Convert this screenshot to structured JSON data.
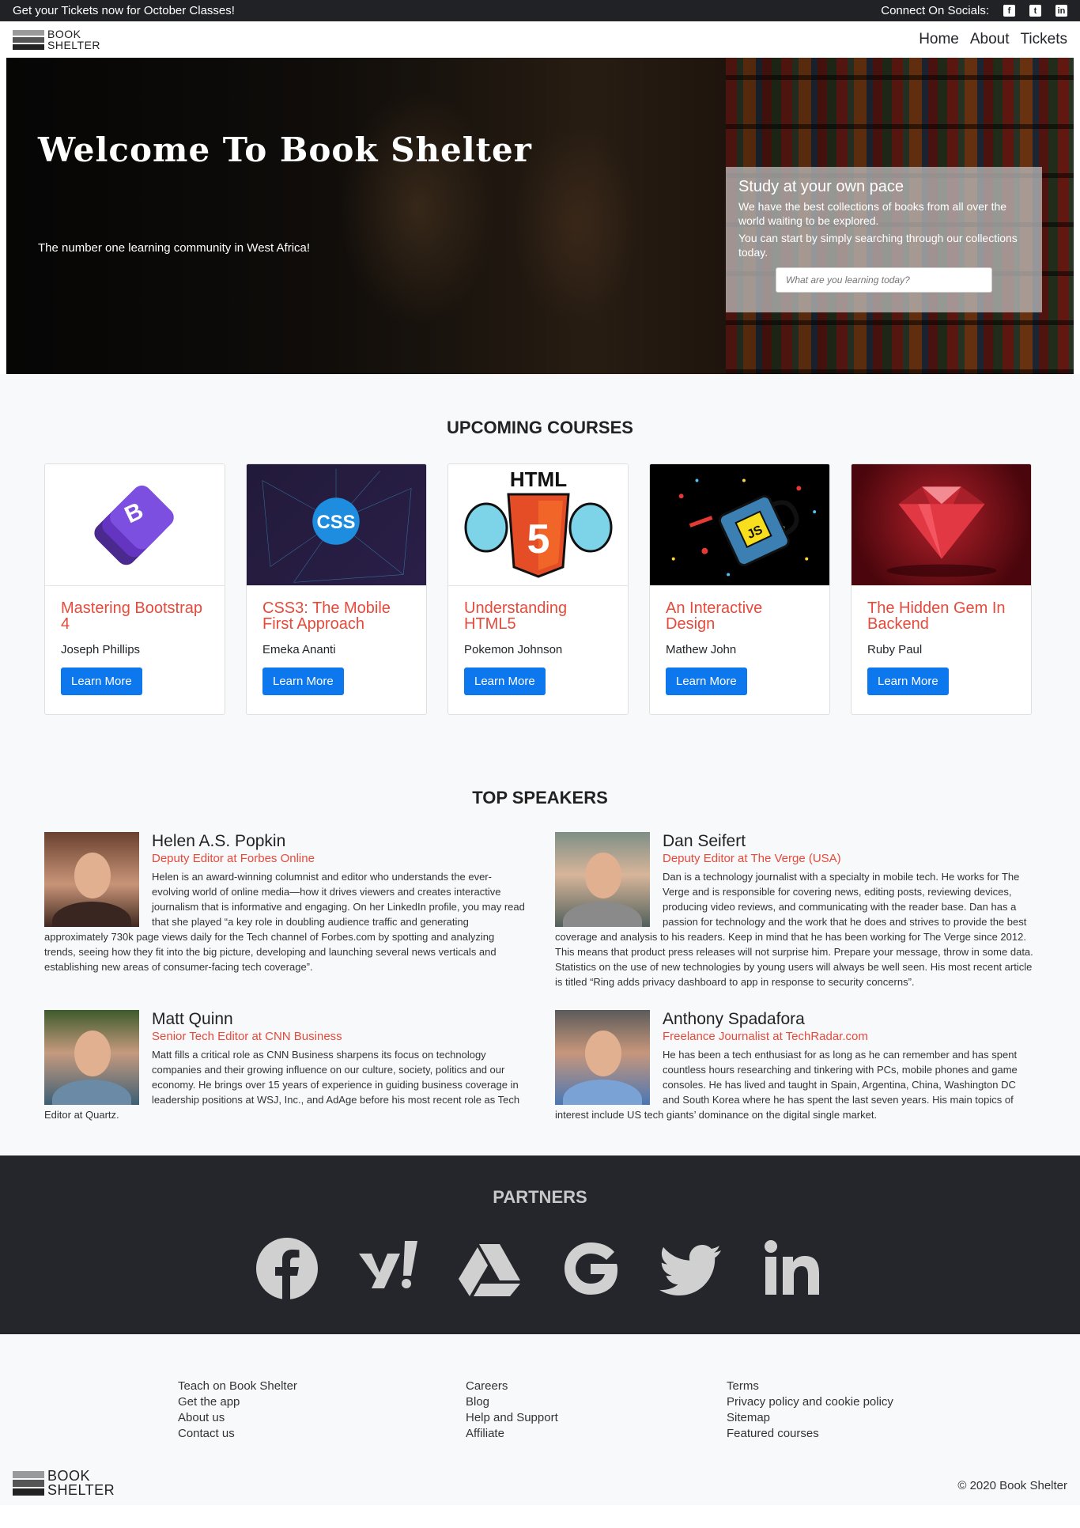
{
  "topbar": {
    "announcement": "Get your Tickets now for October Classes!",
    "socials_label": "Connect On Socials:",
    "socials": [
      "facebook-icon",
      "twitter-icon",
      "linkedin-icon"
    ]
  },
  "brand": {
    "line1": "BOOK",
    "line2": "SHELTER"
  },
  "nav": {
    "home": "Home",
    "about": "About",
    "tickets": "Tickets"
  },
  "hero": {
    "title": "Welcome To Book Shelter",
    "tagline": "The number one learning community in West Africa!",
    "card": {
      "heading": "Study at your own pace",
      "p1": "We have the best collections of books from all over the world waiting to be explored.",
      "p2": "You can start by simply searching through our collections today.",
      "search_placeholder": "What are you learning today?"
    }
  },
  "courses": {
    "heading": "UPCOMING COURSES",
    "items": [
      {
        "title": "Mastering Bootstrap 4",
        "author": "Joseph Phillips",
        "button": "Learn More"
      },
      {
        "title": "CSS3: The Mobile First Approach",
        "author": "Emeka Ananti",
        "button": "Learn More"
      },
      {
        "title": "Understanding HTML5",
        "author": "Pokemon Johnson",
        "button": "Learn More"
      },
      {
        "title": "An Interactive Design",
        "author": "Mathew John",
        "button": "Learn More"
      },
      {
        "title": "The Hidden Gem In Backend",
        "author": "Ruby Paul",
        "button": "Learn More"
      }
    ],
    "thumb_text": {
      "css": "CSS",
      "html": "HTML",
      "html5": "5",
      "js": "JS"
    }
  },
  "speakers": {
    "heading": "TOP SPEAKERS",
    "items": [
      {
        "name": "Helen A.S. Popkin",
        "role": "Deputy Editor at Forbes Online",
        "bio": "Helen is an award-winning columnist and editor who understands the ever-evolving world of online media—how it drives viewers and creates interactive journalism that is informative and engaging. On her LinkedIn profile, you may read that she played “a key role in doubling audience traffic and generating approximately 730k page views daily for the Tech channel of Forbes.com by spotting and analyzing trends, seeing how they fit into the big picture, developing and launching several news verticals and establishing new areas of consumer-facing tech coverage”."
      },
      {
        "name": "Dan Seifert",
        "role": "Deputy Editor at The Verge (USA)",
        "bio": "Dan is a technology journalist with a specialty in mobile tech. He works for The Verge and is responsible for covering news, editing posts, reviewing devices, producing video reviews, and communicating with the reader base. Dan has a passion for technology and the work that he does and strives to provide the best coverage and analysis to his readers. Keep in mind that he has been working for The Verge since 2012. This means that product press releases will not surprise him. Prepare your message, throw in some data. Statistics on the use of new technologies by young users will always be well seen. His most recent article is titled “Ring adds privacy dashboard to app in response to security concerns”."
      },
      {
        "name": "Matt Quinn",
        "role": "Senior Tech Editor at CNN Business",
        "bio": "Matt fills a critical role as CNN Business sharpens its focus on technology companies and their growing influence on our culture, society, politics and our economy. He brings over 15 years of experience in guiding business coverage in leadership positions at WSJ, Inc., and AdAge before his most recent role as Tech Editor at Quartz."
      },
      {
        "name": "Anthony Spadafora",
        "role": "Freelance Journalist at TechRadar.com",
        "bio": "He has been a tech enthusiast for as long as he can remember and has spent countless hours researching and tinkering with PCs, mobile phones and game consoles. He has lived and taught in Spain, Argentina, China, Washington DC and South Korea where he has spent the last seven years. His main topics of interest include US tech giants’ dominance on the digital single market."
      }
    ]
  },
  "partners": {
    "heading": "PARTNERS",
    "logos": [
      "facebook-icon",
      "yahoo-icon",
      "google-drive-icon",
      "google-icon",
      "twitter-icon",
      "linkedin-icon"
    ]
  },
  "footer": {
    "col1": [
      "Teach on Book Shelter",
      "Get the app",
      "About us",
      "Contact us"
    ],
    "col2": [
      "Careers",
      "Blog",
      "Help and Support",
      "Affiliate"
    ],
    "col3": [
      "Terms",
      "Privacy policy and cookie policy",
      "Sitemap",
      "Featured courses"
    ],
    "copyright": "© 2020 Book Shelter"
  },
  "colors": {
    "accent": "#e64a3b",
    "button": "#0d77ee",
    "dark": "#202226"
  }
}
